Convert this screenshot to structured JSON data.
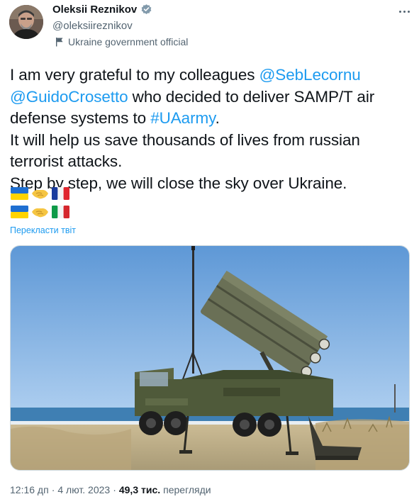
{
  "author": {
    "name": "Oleksii Reznikov",
    "handle": "@oleksiireznikov",
    "affiliation": "Ukraine government official"
  },
  "tweet": {
    "lines": [
      [
        {
          "text": "I am very grateful to my colleagues ",
          "mention": false
        },
        {
          "text": "@SebLecornu",
          "mention": true
        }
      ],
      [
        {
          "text": "@GuidoCrosetto",
          "mention": true
        },
        {
          "text": " who decided to deliver SAMP/T air",
          "mention": false
        }
      ],
      [
        {
          "text": "defense systems to ",
          "mention": false
        },
        {
          "text": "#UAarmy",
          "mention": true
        },
        {
          "text": ".",
          "mention": false
        }
      ],
      [
        {
          "text": "It will help us save thousands of lives from russian",
          "mention": false
        }
      ],
      [
        {
          "text": "terrorist attacks.",
          "mention": false
        }
      ],
      [
        {
          "text": "Step by step, we will close the sky over Ukraine.",
          "mention": false
        }
      ]
    ],
    "emoji_rows": [
      [
        "flag-ukraine-icon",
        "handshake-icon",
        "flag-france-icon"
      ],
      [
        "flag-ukraine-icon",
        "handshake-icon",
        "flag-italy-icon"
      ]
    ],
    "translate_label": "Перекласти твіт"
  },
  "footer": {
    "time": "12:16 дп",
    "separator": "·",
    "date": "4 лют. 2023",
    "separator2": "·",
    "views_count": "49,3 тис.",
    "views_label": "перегляди"
  },
  "colors": {
    "accent": "#1d9bf0",
    "text": "#0f1419",
    "secondary": "#536471",
    "verified_gray": "#829aab"
  }
}
